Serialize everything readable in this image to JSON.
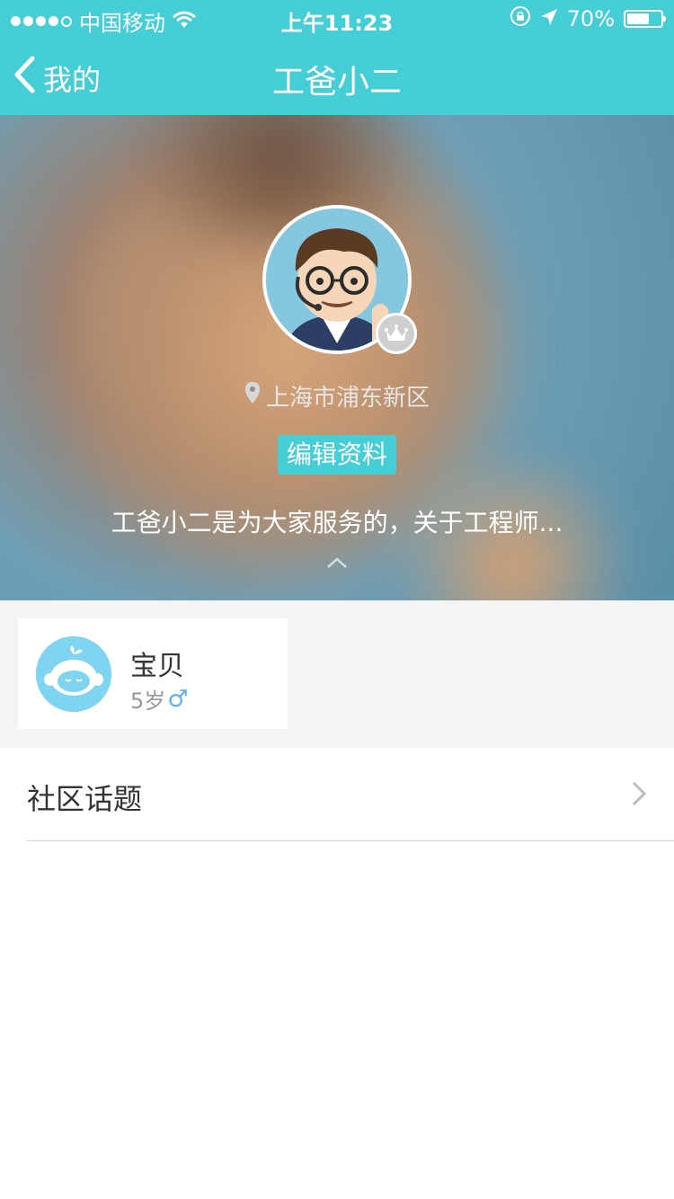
{
  "status_bar": {
    "carrier": "中国移动",
    "time": "上午11:23",
    "battery": "70%",
    "battery_level": 0.7
  },
  "nav": {
    "back_label": "我的",
    "title": "工爸小二"
  },
  "profile": {
    "location": "上海市浦东新区",
    "edit_label": "编辑资料",
    "bio": "工爸小二是为大家服务的，关于工程师..."
  },
  "baby": {
    "name": "宝贝",
    "age": "5岁",
    "gender_symbol": "♂"
  },
  "menu": {
    "topics_label": "社区话题"
  },
  "colors": {
    "accent": "#45ced6",
    "male": "#5ab4f0"
  }
}
